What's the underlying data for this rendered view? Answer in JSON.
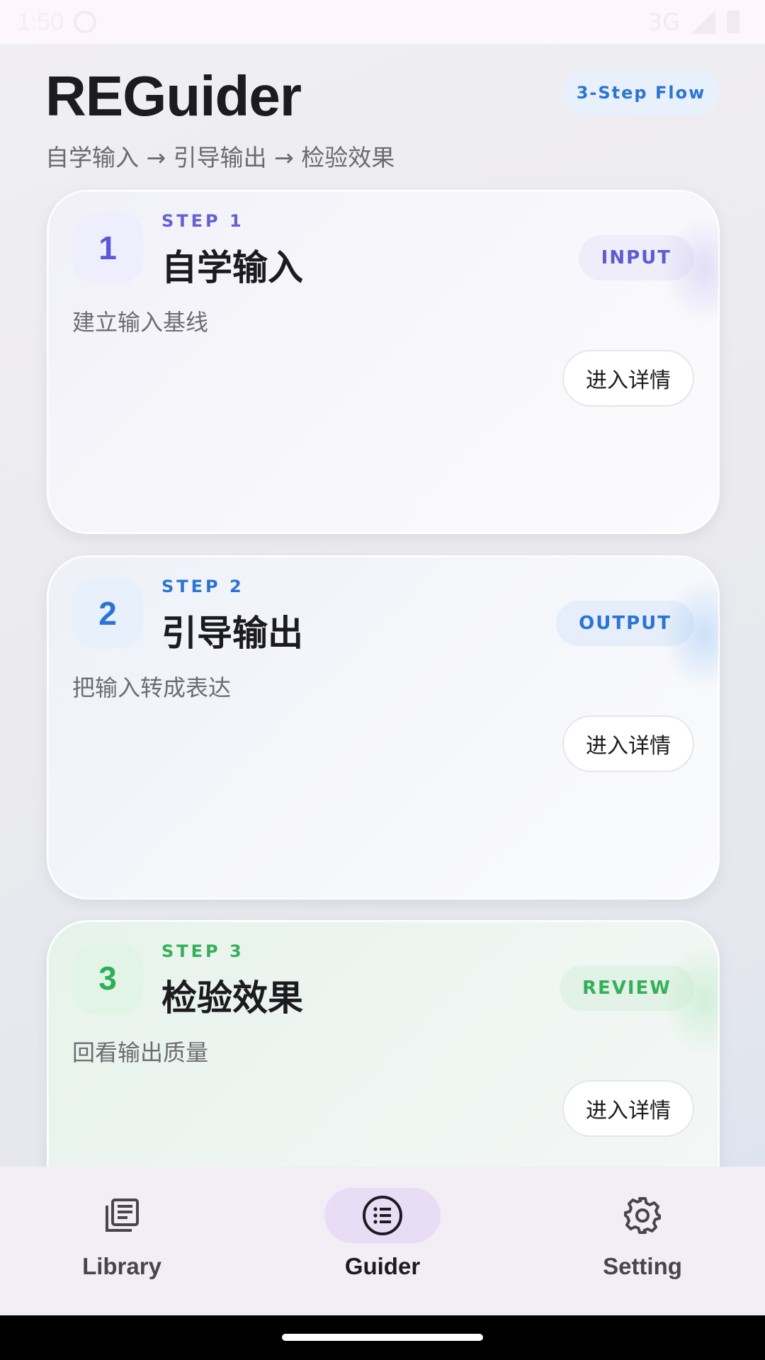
{
  "status_bar": {
    "time": "1:50",
    "network": "3G"
  },
  "header": {
    "title": "REGuider",
    "flow_chip": "3-Step Flow",
    "subtitle": "自学输入 → 引导输出 → 检验效果"
  },
  "steps": [
    {
      "number": "1",
      "label": "STEP 1",
      "title": "自学输入",
      "tag": "INPUT",
      "description": "建立输入基线",
      "button": "进入详情",
      "accent": "#5b57d6"
    },
    {
      "number": "2",
      "label": "STEP 2",
      "title": "引导输出",
      "tag": "OUTPUT",
      "description": "把输入转成表达",
      "button": "进入详情",
      "accent": "#2b74d4"
    },
    {
      "number": "3",
      "label": "STEP 3",
      "title": "检验效果",
      "tag": "REVIEW",
      "description": "回看输出质量",
      "button": "进入详情",
      "accent": "#35b05a"
    }
  ],
  "nav": {
    "items": [
      {
        "label": "Library",
        "icon": "library-icon",
        "selected": false
      },
      {
        "label": "Guider",
        "icon": "list-icon",
        "selected": true
      },
      {
        "label": "Setting",
        "icon": "gear-icon",
        "selected": false
      }
    ],
    "selected_bg": "#e9ddf6"
  }
}
